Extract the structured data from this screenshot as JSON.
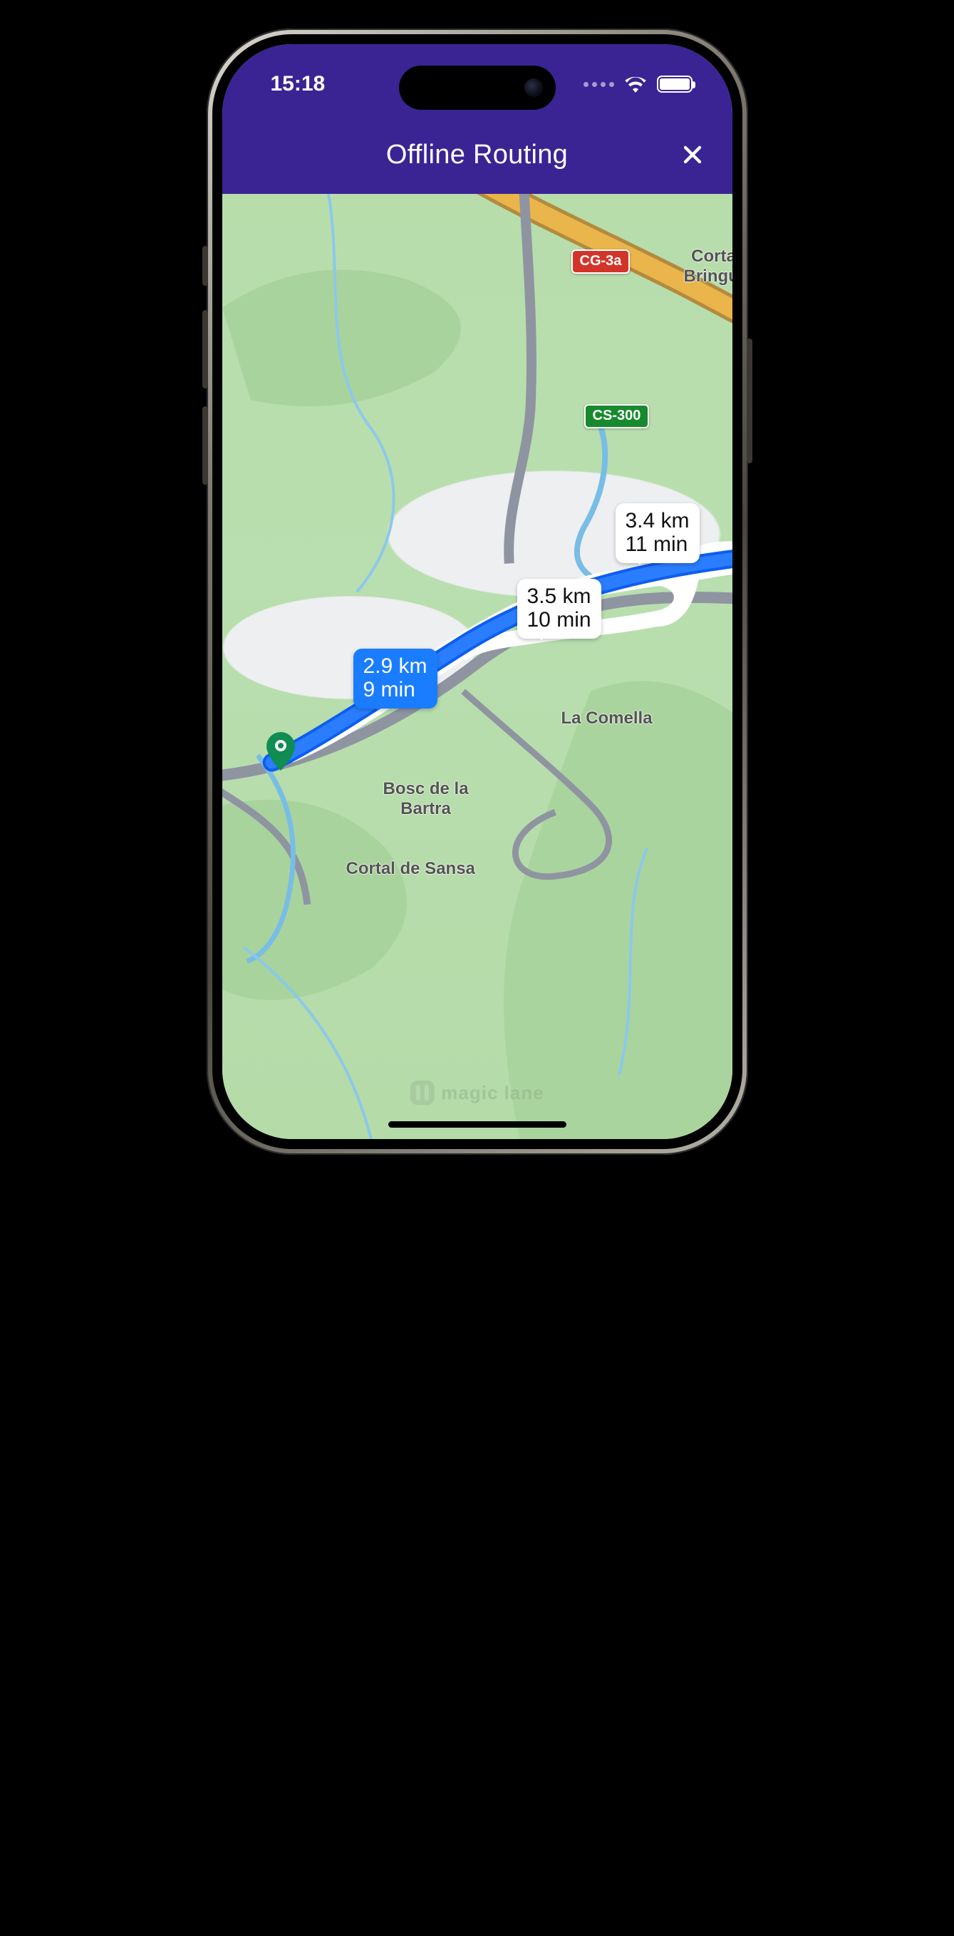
{
  "status": {
    "time": "15:18"
  },
  "nav": {
    "title": "Offline Routing"
  },
  "routes": {
    "selected": {
      "distance": "2.9 km",
      "duration": "9 min"
    },
    "alt1": {
      "distance": "3.5 km",
      "duration": "10 min"
    },
    "alt2": {
      "distance": "3.4 km",
      "duration": "11 min"
    }
  },
  "shields": {
    "cg3a": "CG-3a",
    "cs300": "CS-300"
  },
  "places": {
    "cortal_bringue": "Cortal\nBringué",
    "la_comella": "La Comella",
    "bosc_bartra": "Bosc de la\nBartra",
    "cortal_sansa": "Cortal de Sansa"
  },
  "watermark": "magic lane",
  "colors": {
    "accent": "#3a2494",
    "route_selected": "#1a7cff"
  }
}
